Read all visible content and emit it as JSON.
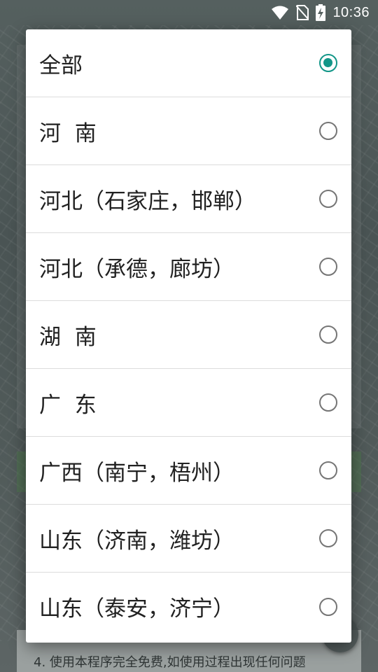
{
  "status_bar": {
    "time": "10:36",
    "icons": [
      "wifi-icon",
      "no-sim-icon",
      "battery-charging-icon"
    ]
  },
  "dialog": {
    "accent_color": "#129688",
    "options": [
      {
        "label": "全部",
        "checked": true
      },
      {
        "label": "河  南",
        "checked": false
      },
      {
        "label": "河北（石家庄，邯郸）",
        "checked": false
      },
      {
        "label": "河北（承德，廊坊）",
        "checked": false
      },
      {
        "label": "湖  南",
        "checked": false
      },
      {
        "label": "广  东",
        "checked": false
      },
      {
        "label": "广西（南宁，梧州）",
        "checked": false
      },
      {
        "label": "山东（济南，潍坊）",
        "checked": false
      },
      {
        "label": "山东（泰安，济宁）",
        "checked": false
      }
    ]
  },
  "background": {
    "footer_text": "4. 使用本程序完全免费,如使用过程出现任何问题"
  }
}
